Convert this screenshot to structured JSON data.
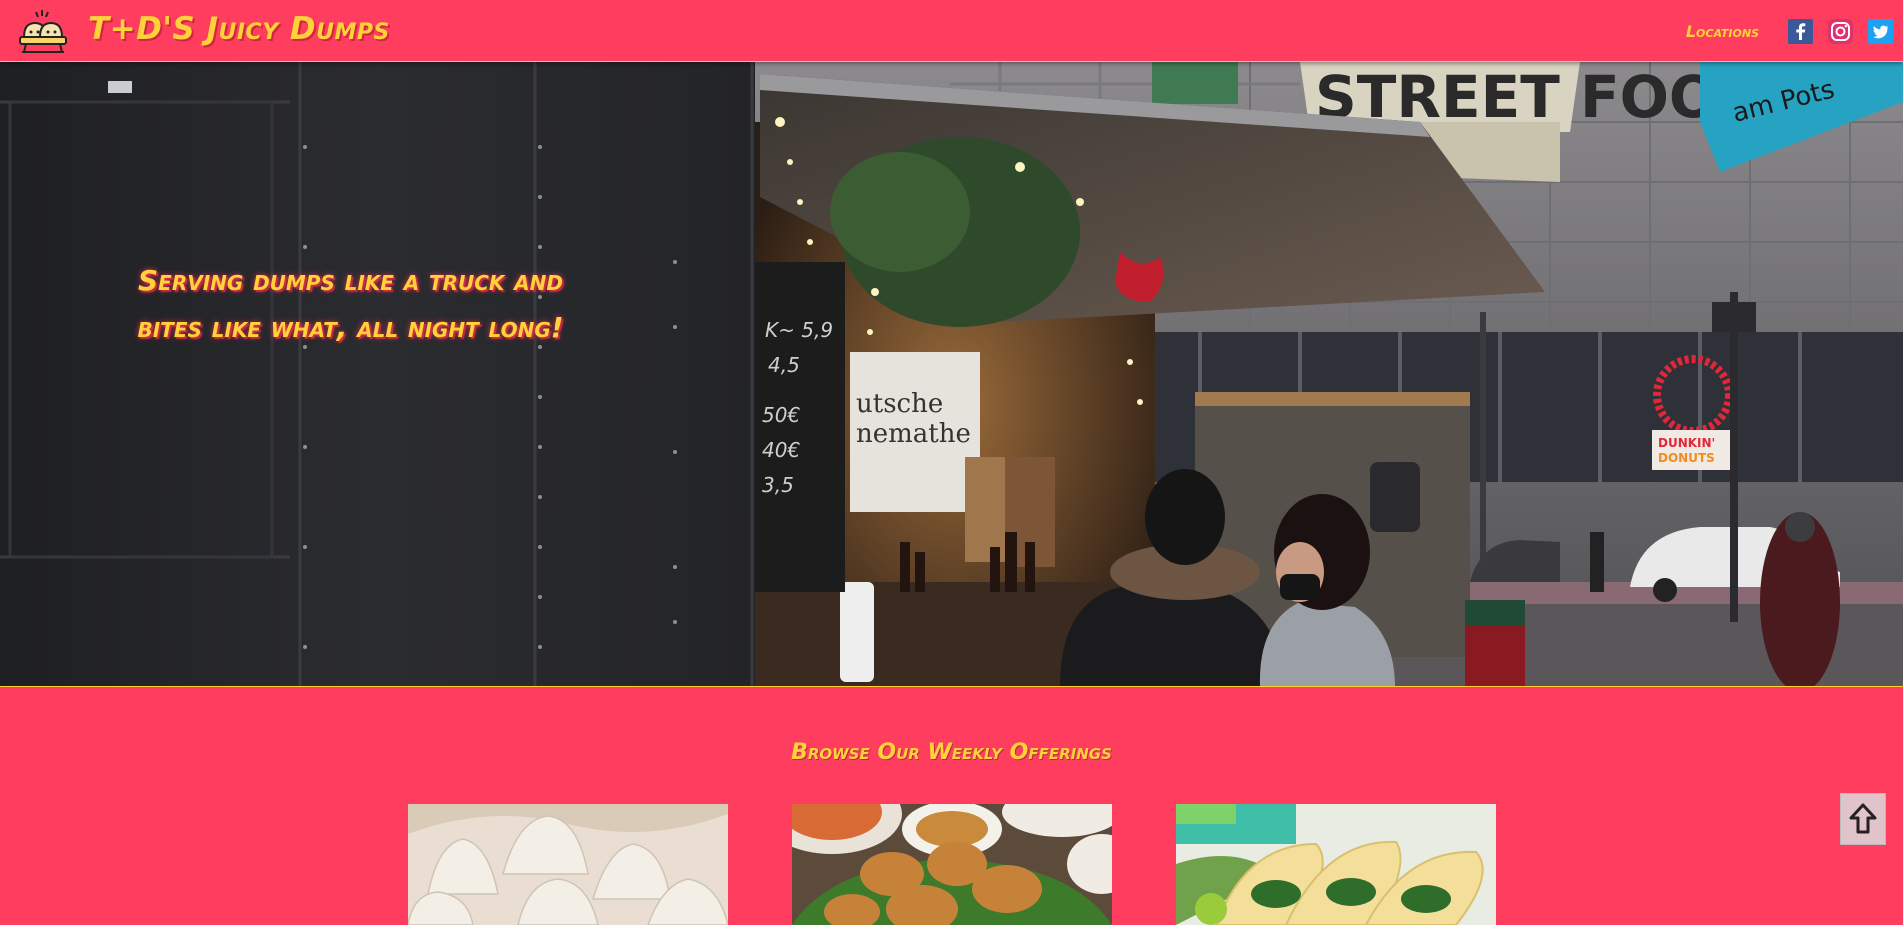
{
  "header": {
    "brand": "T+D'S Juicy Dumps",
    "logo_icon": "dumpling-bowl-icon",
    "nav_locations": "Locations",
    "social": [
      {
        "name": "facebook-icon",
        "color": "#3b5998"
      },
      {
        "name": "instagram-icon",
        "color": "#d6249f"
      },
      {
        "name": "twitter-icon",
        "color": "#1da1f2"
      }
    ]
  },
  "hero": {
    "tagline": "Serving dumps like a truck and bites like what, all night long!",
    "sign_text": "STREET FOO",
    "sign_sub": "am Pots",
    "window_text_1": "utsche",
    "window_text_2": "nemathe",
    "donut_text_1": "DUNKIN'",
    "donut_text_2": "DONUTS",
    "chalk_lines": [
      "K~ 5,9",
      "4,5",
      "50€",
      "40€",
      "3,5"
    ]
  },
  "offerings": {
    "title": "Browse Our Weekly Offerings",
    "cards": [
      {
        "name": "soup-dumplings-image"
      },
      {
        "name": "fried-chicken-image"
      },
      {
        "name": "tacos-image"
      }
    ]
  },
  "back_to_top_icon": "arrow-up-icon",
  "colors": {
    "brand_pink": "#ff3e5f",
    "brand_yellow": "#ffd23a"
  }
}
